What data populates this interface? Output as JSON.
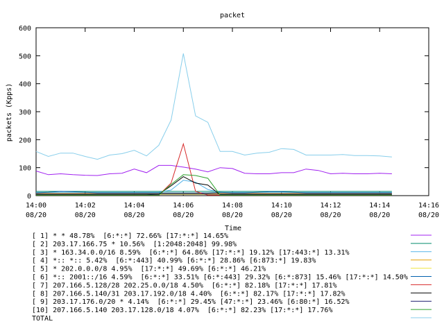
{
  "chart_data": {
    "type": "line",
    "title": "packet",
    "xlabel": "Time",
    "ylabel": "packets (Kpps)",
    "ylim": [
      0,
      600
    ],
    "xlim": [
      "14:00",
      "14:16"
    ],
    "y_ticks": [
      "0",
      "100",
      "200",
      "300",
      "400",
      "500",
      "600"
    ],
    "x_ticks": [
      {
        "time": "14:00",
        "date": "08/20"
      },
      {
        "time": "14:02",
        "date": "08/20"
      },
      {
        "time": "14:04",
        "date": "08/20"
      },
      {
        "time": "14:06",
        "date": "08/20"
      },
      {
        "time": "14:08",
        "date": "08/20"
      },
      {
        "time": "14:10",
        "date": "08/20"
      },
      {
        "time": "14:12",
        "date": "08/20"
      },
      {
        "time": "14:14",
        "date": "08/20"
      },
      {
        "time": "14:16",
        "date": "08/20"
      }
    ],
    "grid": false,
    "legend_position": "bottom",
    "x": [
      "14:00",
      "14:00:30",
      "14:01",
      "14:01:30",
      "14:02",
      "14:02:30",
      "14:03",
      "14:03:30",
      "14:04",
      "14:04:30",
      "14:05",
      "14:05:30",
      "14:06",
      "14:06:30",
      "14:07",
      "14:07:30",
      "14:08",
      "14:08:30",
      "14:09",
      "14:09:30",
      "14:10",
      "14:10:30",
      "14:11",
      "14:11:30",
      "14:12",
      "14:12:30",
      "14:13",
      "14:13:30",
      "14:14",
      "14:14:30"
    ],
    "series": [
      {
        "name": "[ 1] * * 48.78%  [6:*:*] 72.66% [17:*:*] 14.65%",
        "color": "#a020f0",
        "values": [
          88,
          75,
          78,
          75,
          73,
          72,
          78,
          80,
          95,
          82,
          108,
          108,
          102,
          95,
          85,
          100,
          97,
          80,
          78,
          78,
          82,
          82,
          95,
          90,
          78,
          80,
          78,
          78,
          80,
          78
        ]
      },
      {
        "name": "[ 2] 203.17.166.75 * 10.56%  [1:2048:2048] 99.98%",
        "color": "#008b6b",
        "values": [
          15,
          15,
          15,
          15,
          15,
          15,
          15,
          15,
          15,
          15,
          15,
          15,
          15,
          15,
          15,
          15,
          15,
          15,
          15,
          15,
          15,
          15,
          15,
          15,
          15,
          15,
          15,
          15,
          15,
          15
        ]
      },
      {
        "name": "[ 3] * 163.34.0.0/16 8.59%  [6:*:*] 64.86% [17:*:*] 19.12% [17:443:*] 13.31%",
        "color": "#56b4e9",
        "values": [
          12,
          12,
          12,
          12,
          12,
          12,
          12,
          12,
          12,
          12,
          12,
          20,
          55,
          48,
          22,
          12,
          12,
          12,
          12,
          12,
          12,
          12,
          12,
          12,
          12,
          12,
          12,
          12,
          12,
          12
        ]
      },
      {
        "name": "[ 4] *:: *:: 5.42%  [6:*:443] 40.99% [6:*:*] 28.86% [6:873:*] 19.83%",
        "color": "#e69f00",
        "values": [
          8,
          8,
          8,
          8,
          8,
          8,
          8,
          8,
          8,
          8,
          8,
          8,
          8,
          8,
          8,
          8,
          8,
          8,
          8,
          8,
          8,
          8,
          8,
          8,
          8,
          8,
          8,
          8,
          8,
          8
        ]
      },
      {
        "name": "[ 5] * 202.0.0.0/8 4.95%  [17:*:*] 49.69% [6:*:*] 46.21%",
        "color": "#f0e442",
        "values": [
          4,
          4,
          4,
          4,
          4,
          4,
          4,
          4,
          4,
          4,
          4,
          4,
          4,
          4,
          4,
          4,
          4,
          4,
          4,
          4,
          4,
          4,
          4,
          4,
          4,
          4,
          4,
          4,
          4,
          4
        ]
      },
      {
        "name": "[ 6] *:: 2001::/16 4.59%  [6:*:*] 33.51% [6:*:443] 29.32% [6:*:873] 15.46% [17:*:*] 14.50%",
        "color": "#0060ad",
        "values": [
          10,
          12,
          15,
          14,
          12,
          10,
          10,
          10,
          10,
          10,
          10,
          10,
          10,
          10,
          10,
          12,
          10,
          10,
          12,
          14,
          14,
          12,
          10,
          10,
          10,
          10,
          10,
          10,
          10,
          10
        ]
      },
      {
        "name": "[ 7] 207.166.5.128/28 202.25.0.0/18 4.50%  [6:*:*] 82.18% [17:*:*] 17.81%",
        "color": "#d62728",
        "values": [
          2,
          2,
          2,
          2,
          2,
          2,
          2,
          2,
          2,
          2,
          2,
          45,
          185,
          15,
          2,
          2,
          2,
          2,
          2,
          2,
          2,
          2,
          2,
          2,
          2,
          2,
          2,
          2,
          2,
          2
        ]
      },
      {
        "name": "[ 8] 207.166.5.140/31 203.17.192.0/18 4.40%  [6:*:*] 82.17% [17:*:*] 17.82%",
        "color": "#000000",
        "values": [
          3,
          3,
          3,
          3,
          3,
          3,
          3,
          3,
          3,
          3,
          5,
          35,
          68,
          45,
          38,
          3,
          3,
          3,
          3,
          3,
          3,
          3,
          3,
          3,
          3,
          3,
          3,
          3,
          3,
          3
        ]
      },
      {
        "name": "[ 9] 203.17.176.0/20 * 4.14%  [6:*:*] 29.45% [47:*:*] 23.46% [6:80:*] 16.52%",
        "color": "#1a1a6e",
        "values": [
          6,
          6,
          6,
          6,
          6,
          6,
          6,
          6,
          6,
          6,
          6,
          6,
          6,
          6,
          6,
          6,
          6,
          6,
          6,
          6,
          6,
          6,
          6,
          6,
          6,
          6,
          6,
          6,
          6,
          6
        ]
      },
      {
        "name": "[10] 207.166.5.140 203.17.128.0/18 4.07%  [6:*:*] 82.23% [17:*:*] 17.76%",
        "color": "#2ca02c",
        "values": [
          2,
          2,
          2,
          2,
          2,
          2,
          2,
          2,
          2,
          2,
          2,
          40,
          75,
          72,
          62,
          2,
          2,
          2,
          2,
          2,
          2,
          2,
          2,
          2,
          2,
          2,
          2,
          2,
          2,
          2
        ]
      },
      {
        "name": "TOTAL",
        "color": "#87ceeb",
        "values": [
          158,
          140,
          152,
          152,
          140,
          130,
          145,
          150,
          162,
          142,
          180,
          270,
          508,
          285,
          262,
          158,
          158,
          145,
          152,
          155,
          168,
          165,
          145,
          145,
          145,
          147,
          143,
          143,
          142,
          138
        ]
      }
    ]
  }
}
